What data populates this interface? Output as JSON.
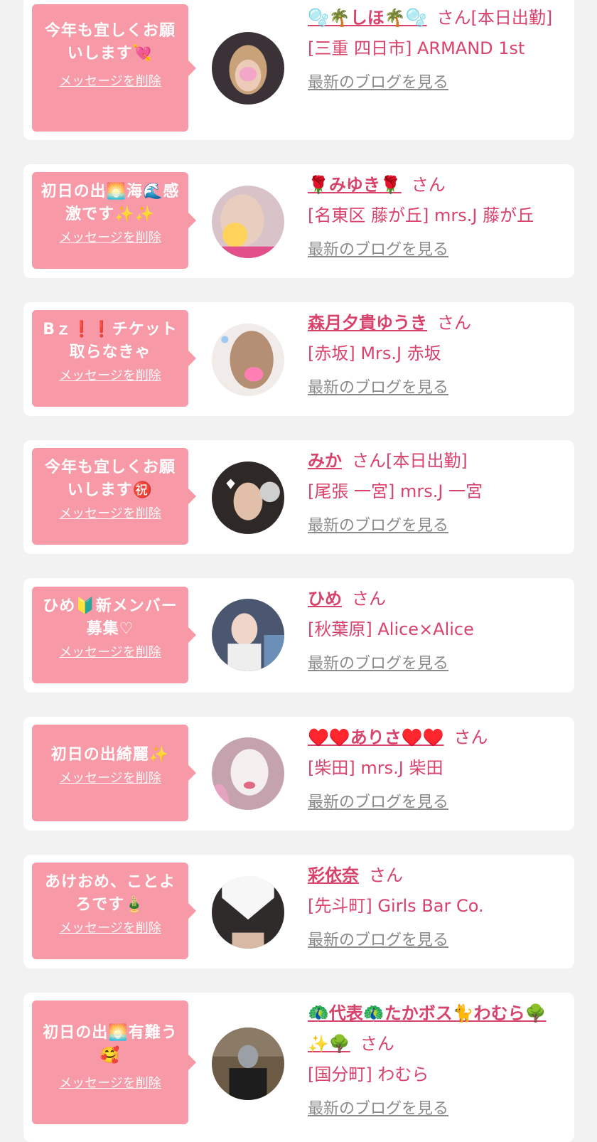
{
  "delete_label": "メッセージを削除",
  "blog_label": "最新のブログを見る",
  "san_label": "さん",
  "colors": {
    "background": "#f2f2f2",
    "card": "#ffffff",
    "bubble": "#f799a6",
    "accent_text": "#d8436b",
    "link_gray": "#8a8a8a"
  },
  "entries": [
    {
      "message": "今年も宜しくお願いします💘",
      "name": "🫧🌴しほ🌴🫧",
      "status": "[本日出勤]",
      "shop": "[三重 四日市] ARMAND 1st"
    },
    {
      "message": "初日の出🌅海🌊感激です✨✨",
      "name": "🌹みゆき🌹",
      "status": "",
      "shop": "[名東区 藤が丘] mrs.J 藤が丘"
    },
    {
      "message": "Bｚ❗️❗️チケット取らなきゃ",
      "name": "森月夕貴ゆうき",
      "status": "",
      "shop": "[赤坂] Mrs.J 赤坂"
    },
    {
      "message": "今年も宜しくお願いします㊗️",
      "name": "みか",
      "status": "[本日出勤]",
      "shop": "[尾張 一宮] mrs.J 一宮"
    },
    {
      "message": "ひめ🔰新メンバー募集♡",
      "name": "ひめ",
      "status": "",
      "shop": "[秋葉原] Alice×Alice"
    },
    {
      "message": "初日の出綺麗✨",
      "name": "♥️♥️ありさ♥️♥️",
      "status": "",
      "shop": "[柴田] mrs.J 柴田"
    },
    {
      "message": "あけおめ、ことよろです🎍",
      "name": "彩依奈",
      "status": "",
      "shop": "[先斗町] Girls Bar Co."
    },
    {
      "message": "初日の出🌅有難う🥰",
      "name": "🦚代表🦚たかボス🐈わむら🌳✨🌳",
      "status": "",
      "shop": "[国分町] わむら"
    }
  ]
}
